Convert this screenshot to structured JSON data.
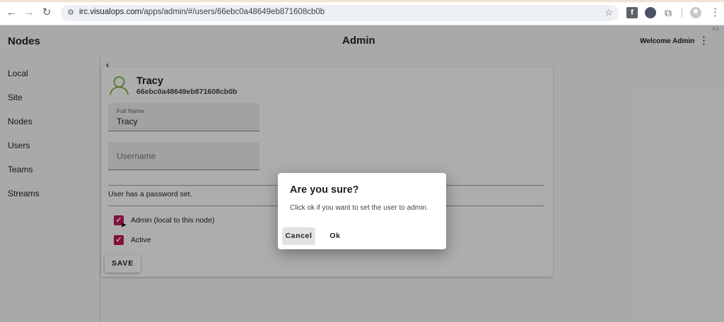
{
  "browser": {
    "url_host": "irc.visualops.com",
    "url_path": "/apps/admin/#/users/66ebc0a48649eb871608cb0b",
    "back": "←",
    "forward": "→",
    "reload": "↻",
    "star": "☆",
    "ext_fb": "f",
    "puzzle": "⧉",
    "menu": "⋮"
  },
  "app": {
    "title": "Nodes",
    "page_title": "Admin",
    "welcome": "Welcome Admin",
    "menu_icon": "⋮",
    "version": "0.1"
  },
  "sidebar": {
    "items": [
      {
        "label": "Local"
      },
      {
        "label": "Site"
      },
      {
        "label": "Nodes"
      },
      {
        "label": "Users"
      },
      {
        "label": "Teams"
      },
      {
        "label": "Streams"
      }
    ]
  },
  "user": {
    "back_icon": "‹",
    "name": "Tracy",
    "id": "66ebc0a48649eb871608cb0b",
    "full_name_label": "Full Name",
    "full_name_value": "Tracy",
    "username_placeholder": "Username",
    "password_status": "User has a password set.",
    "admin_label": "Admin (local to this node)",
    "active_label": "Active",
    "checkmark": "✓",
    "save_label": "SAVE"
  },
  "dialog": {
    "title": "Are you sure?",
    "message": "Click ok if you want to set the user to admin.",
    "cancel_label": "Cancel",
    "ok_label": "Ok"
  },
  "colors": {
    "accent": "#c2185b",
    "avatar": "#7cb342"
  }
}
